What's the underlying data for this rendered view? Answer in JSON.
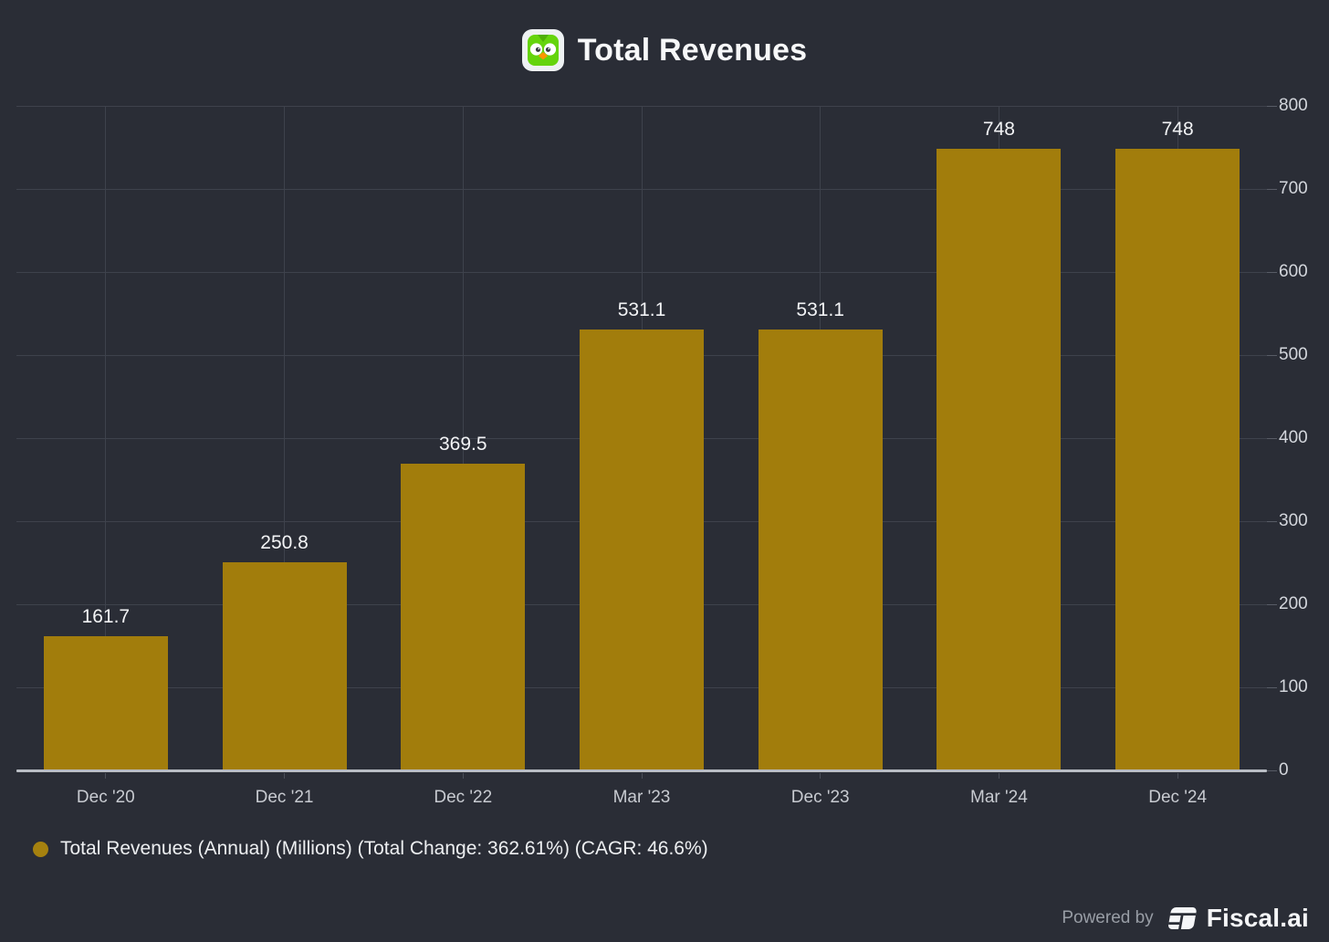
{
  "header": {
    "title": "Total Revenues",
    "icon": "duolingo-app-icon"
  },
  "chart_data": {
    "type": "bar",
    "title": "Total Revenues",
    "categories": [
      "Dec '20",
      "Dec '21",
      "Dec '22",
      "Mar '23",
      "Dec '23",
      "Mar '24",
      "Dec '24"
    ],
    "values": [
      161.7,
      250.8,
      369.5,
      531.1,
      531.1,
      748,
      748
    ],
    "value_labels": [
      "161.7",
      "250.8",
      "369.5",
      "531.1",
      "531.1",
      "748",
      "748"
    ],
    "ylim": [
      0,
      800
    ],
    "yticks": [
      0,
      100,
      200,
      300,
      400,
      500,
      600,
      700,
      800
    ],
    "y_axis_side": "right",
    "grid": true,
    "bar_color": "#a27d0c",
    "legend_position": "bottom-left"
  },
  "legend": {
    "marker_color": "#a5810f",
    "label": "Total Revenues (Annual) (Millions) (Total Change: 362.61%) (CAGR: 46.6%)"
  },
  "footer": {
    "powered_by": "Powered by",
    "brand": "Fiscal.ai"
  },
  "colors": {
    "background": "#2a2d36",
    "gridline": "#3e424c",
    "axis_line": "#b9bdc4",
    "bar": "#a27d0c",
    "text_primary": "#f7f8f9",
    "text_secondary": "#c8cbd1"
  }
}
